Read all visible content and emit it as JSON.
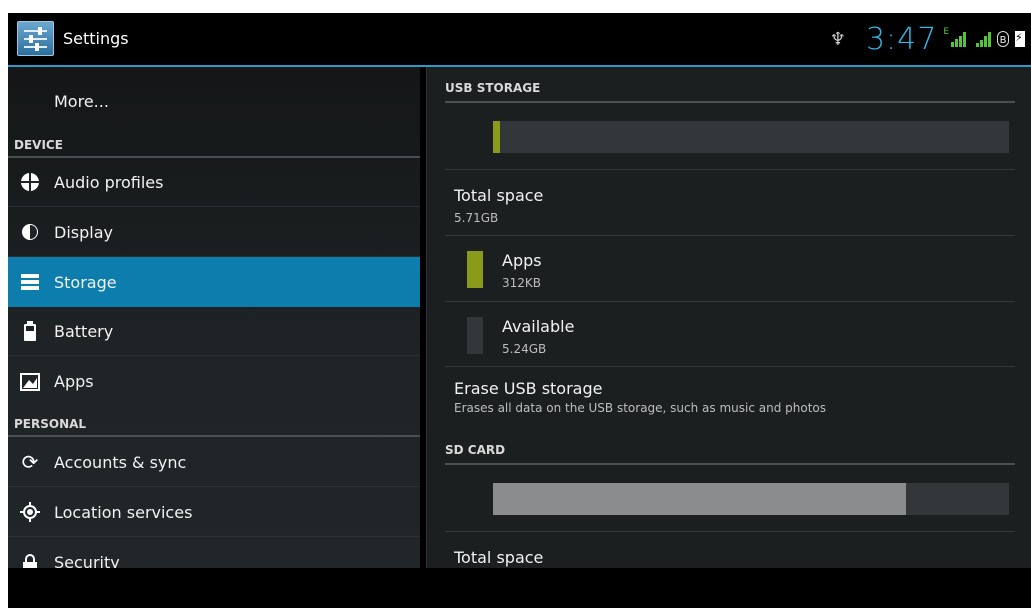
{
  "actionbar": {
    "title": "Settings",
    "icon": "settings-sliders-icon",
    "accent": "#2b9ac9"
  },
  "status": {
    "time": "3:47",
    "usb_icon": "usb-icon",
    "signal_label": "E",
    "bluetooth_icon": "bluetooth-icon",
    "battery_icon": "battery-charging-icon"
  },
  "sidebar": {
    "more_label": "More...",
    "device_header": "DEVICE",
    "personal_header": "PERSONAL",
    "items": [
      {
        "label": "Audio profiles",
        "icon": "audio-profiles-icon"
      },
      {
        "label": "Display",
        "icon": "display-icon"
      },
      {
        "label": "Storage",
        "icon": "storage-icon",
        "selected": true
      },
      {
        "label": "Battery",
        "icon": "battery-icon"
      },
      {
        "label": "Apps",
        "icon": "apps-icon"
      },
      {
        "label": "Accounts & sync",
        "icon": "sync-icon"
      },
      {
        "label": "Location services",
        "icon": "location-icon"
      },
      {
        "label": "Security",
        "icon": "lock-icon"
      }
    ],
    "selected_color": "#0c7dac"
  },
  "storage": {
    "usb_header": "USB STORAGE",
    "usb_used_fraction": 0.013,
    "total_space_label": "Total space",
    "total_space_value": "5.71GB",
    "apps_label": "Apps",
    "apps_value": "312KB",
    "apps_color": "#8a9a1a",
    "available_label": "Available",
    "available_value": "5.24GB",
    "available_color": "#333739",
    "erase_label": "Erase USB storage",
    "erase_desc": "Erases all data on the USB storage, such as music and photos",
    "sd_header": "SD CARD",
    "sd_used_fraction": 0.8,
    "sd_total_label": "Total space"
  }
}
